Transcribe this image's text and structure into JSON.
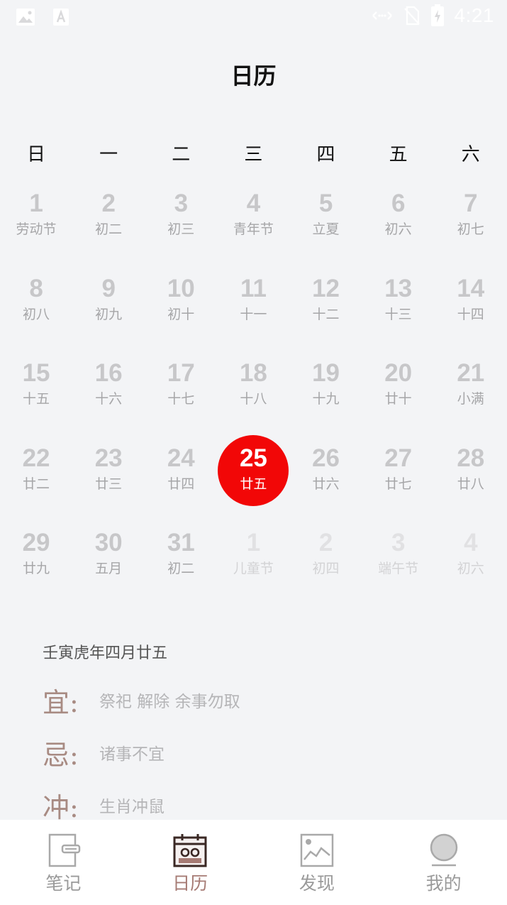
{
  "status_bar": {
    "time": "4:21",
    "icons_left": [
      "image-icon",
      "font-a-icon"
    ],
    "icons_right": [
      "data-transfer-icon",
      "no-sim-icon",
      "battery-charging-icon"
    ]
  },
  "header": {
    "title": "日历"
  },
  "weekdays": [
    "日",
    "一",
    "二",
    "三",
    "四",
    "五",
    "六"
  ],
  "calendar": {
    "selected": "25",
    "weeks": [
      [
        {
          "num": "1",
          "lunar": "劳动节"
        },
        {
          "num": "2",
          "lunar": "初二"
        },
        {
          "num": "3",
          "lunar": "初三"
        },
        {
          "num": "4",
          "lunar": "青年节"
        },
        {
          "num": "5",
          "lunar": "立夏"
        },
        {
          "num": "6",
          "lunar": "初六"
        },
        {
          "num": "7",
          "lunar": "初七"
        }
      ],
      [
        {
          "num": "8",
          "lunar": "初八"
        },
        {
          "num": "9",
          "lunar": "初九"
        },
        {
          "num": "10",
          "lunar": "初十"
        },
        {
          "num": "11",
          "lunar": "十一"
        },
        {
          "num": "12",
          "lunar": "十二"
        },
        {
          "num": "13",
          "lunar": "十三"
        },
        {
          "num": "14",
          "lunar": "十四"
        }
      ],
      [
        {
          "num": "15",
          "lunar": "十五"
        },
        {
          "num": "16",
          "lunar": "十六"
        },
        {
          "num": "17",
          "lunar": "十七"
        },
        {
          "num": "18",
          "lunar": "十八"
        },
        {
          "num": "19",
          "lunar": "十九"
        },
        {
          "num": "20",
          "lunar": "廿十"
        },
        {
          "num": "21",
          "lunar": "小满"
        }
      ],
      [
        {
          "num": "22",
          "lunar": "廿二"
        },
        {
          "num": "23",
          "lunar": "廿三"
        },
        {
          "num": "24",
          "lunar": "廿四"
        },
        {
          "num": "25",
          "lunar": "廿五",
          "selected": true
        },
        {
          "num": "26",
          "lunar": "廿六"
        },
        {
          "num": "27",
          "lunar": "廿七"
        },
        {
          "num": "28",
          "lunar": "廿八"
        }
      ],
      [
        {
          "num": "29",
          "lunar": "廿九"
        },
        {
          "num": "30",
          "lunar": "五月"
        },
        {
          "num": "31",
          "lunar": "初二"
        },
        {
          "num": "1",
          "lunar": "儿童节",
          "other": true
        },
        {
          "num": "2",
          "lunar": "初四",
          "other": true
        },
        {
          "num": "3",
          "lunar": "端午节",
          "other": true
        },
        {
          "num": "4",
          "lunar": "初六",
          "other": true
        }
      ]
    ]
  },
  "almanac": {
    "lunar_date": "壬寅虎年四月廿五",
    "yi": {
      "key": "宜:",
      "value": "祭祀 解除 余事勿取"
    },
    "ji": {
      "key": "忌:",
      "value": "诸事不宜"
    },
    "chong": {
      "key": "冲:",
      "value": "生肖冲鼠"
    }
  },
  "tabs": [
    {
      "label": "笔记",
      "icon": "notebook-icon",
      "active": false
    },
    {
      "label": "日历",
      "icon": "calendar-icon",
      "active": true
    },
    {
      "label": "发现",
      "icon": "chart-picture-icon",
      "active": false
    },
    {
      "label": "我的",
      "icon": "profile-circle-icon",
      "active": false
    }
  ],
  "colors": {
    "selected_day": "#f20707",
    "active_tab": "#a67b74",
    "almanac_key": "#a88b83"
  }
}
